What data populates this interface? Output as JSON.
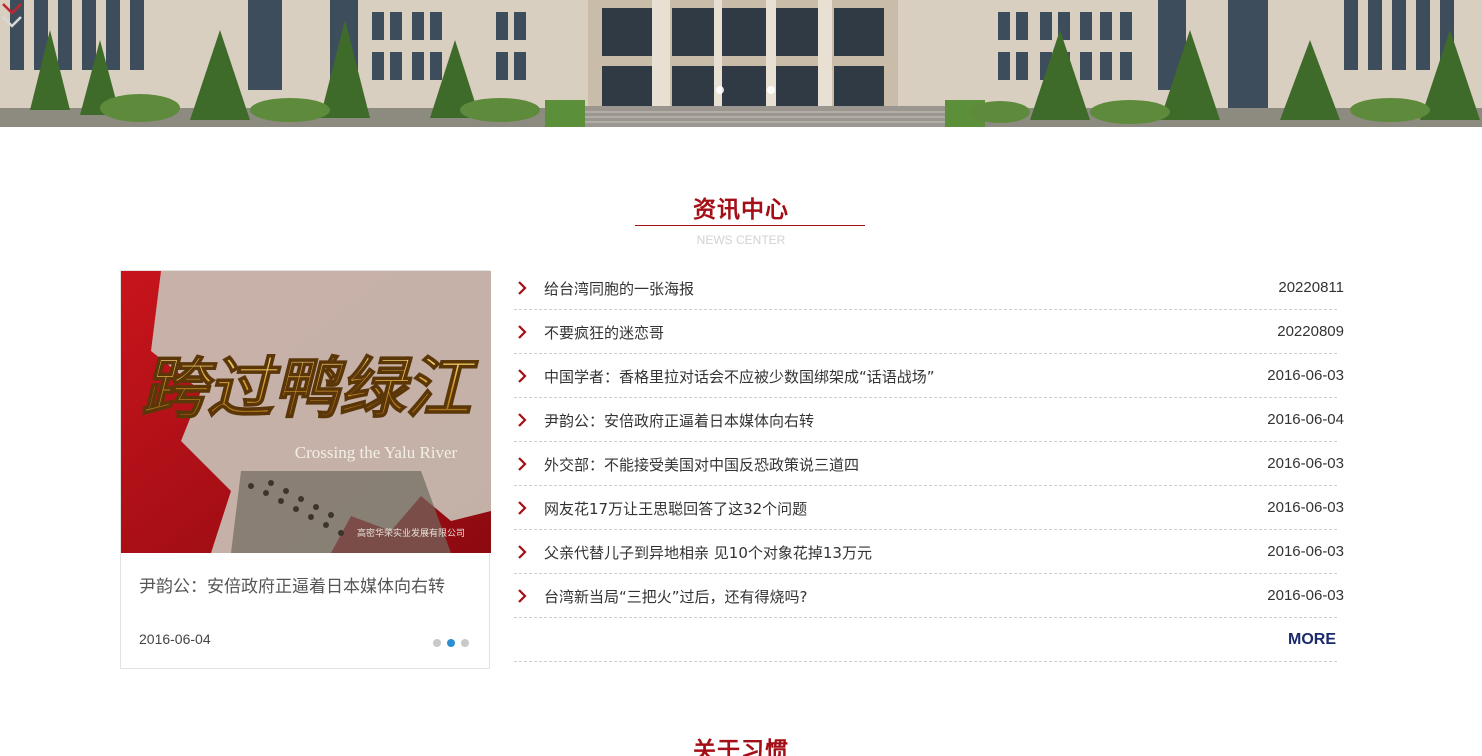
{
  "hero": {
    "slide_count": 2,
    "active_slide": 2,
    "scroll_icon": "double-chevron-down-icon"
  },
  "news_section": {
    "title": "资讯中心",
    "subtitle": "NEWS CENTER",
    "accent_color": "#a40e17",
    "featured": {
      "image_text": "跨过鸭绿江",
      "image_caption": "Crossing the Yalu River",
      "image_watermark": "高密华荣实业发展有限公司",
      "title": "尹韵公：安倍政府正逼着日本媒体向右转",
      "date": "2016-06-04",
      "dots": 3,
      "active_dot": 2
    },
    "items": [
      {
        "title": "给台湾同胞的一张海报",
        "date": "20220811"
      },
      {
        "title": "不要疯狂的迷恋哥",
        "date": "20220809"
      },
      {
        "title": "中国学者：香格里拉对话会不应被少数国绑架成“话语战场”",
        "date": "2016-06-03"
      },
      {
        "title": "尹韵公：安倍政府正逼着日本媒体向右转",
        "date": "2016-06-04"
      },
      {
        "title": "外交部：不能接受美国对中国反恐政策说三道四",
        "date": "2016-06-03"
      },
      {
        "title": "网友花17万让王思聪回答了这32个问题",
        "date": "2016-06-03"
      },
      {
        "title": "父亲代替儿子到异地相亲 见10个对象花掉13万元",
        "date": "2016-06-03"
      },
      {
        "title": "台湾新当局“三把火”过后，还有得烧吗?",
        "date": "2016-06-03"
      }
    ],
    "more_label": "MORE",
    "more_color": "#1a2a6c"
  },
  "about_section": {
    "title": "关于习惯"
  }
}
